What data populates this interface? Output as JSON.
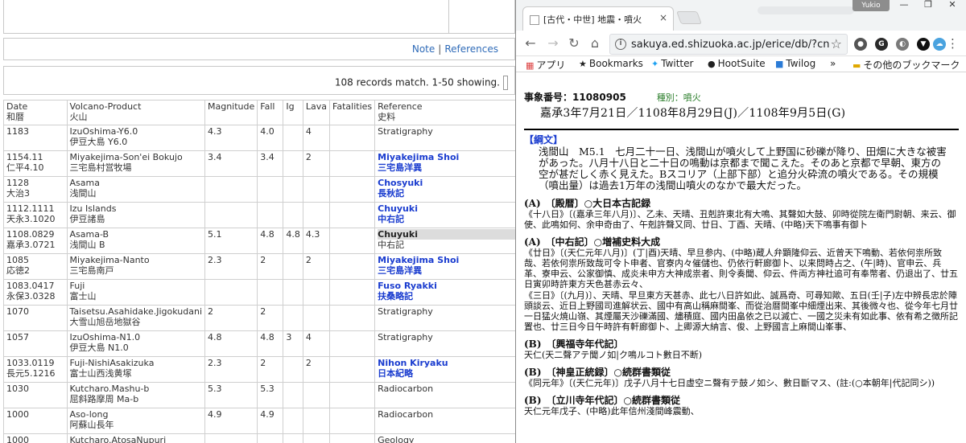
{
  "left": {
    "notes": {
      "note_label": "Note",
      "sep": "|",
      "references_label": "References"
    },
    "records_text": "108 records match. 1-50 showing.",
    "headers": {
      "date": "Date",
      "date_jp": "和暦",
      "product": "Volcano-Product",
      "product_jp": "火山",
      "magnitude": "Magnitude",
      "fall": "Fall",
      "ig": "Ig",
      "lava": "Lava",
      "fatalities": "Fatalities",
      "reference": "Reference",
      "reference_jp": "史料"
    },
    "rows": [
      {
        "date": "1183",
        "date_jp": "",
        "product": "IzuOshima-Y6.0",
        "product_jp": "伊豆大島 Y6.0",
        "mag": "4.3",
        "fall": "4.0",
        "ig": "",
        "lava": "4",
        "fat": "",
        "ref": "Stratigraphy",
        "ref_jp": "",
        "ref_style": "plain"
      },
      {
        "date": "1154.11",
        "date_jp": "仁平4.10",
        "product": "Miyakejima-Son'ei Bokujo",
        "product_jp": "三宅島村営牧場",
        "mag": "3.4",
        "fall": "3.4",
        "ig": "",
        "lava": "2",
        "fat": "",
        "ref": "Miyakejima Shoi",
        "ref_jp": "三宅島洋異",
        "ref_style": "link"
      },
      {
        "date": "1128",
        "date_jp": "大治3",
        "product": "Asama",
        "product_jp": "浅間山",
        "mag": "",
        "fall": "",
        "ig": "",
        "lava": "",
        "fat": "",
        "ref": "Chosyuki",
        "ref_jp": "長秋記",
        "ref_style": "link"
      },
      {
        "date": "1112.1111",
        "date_jp": "天永3.1020",
        "product": "Izu Islands",
        "product_jp": "伊豆諸島",
        "mag": "",
        "fall": "",
        "ig": "",
        "lava": "",
        "fat": "",
        "ref": "Chuyuki",
        "ref_jp": "中右記",
        "ref_style": "link"
      },
      {
        "date": "1108.0829",
        "date_jp": "嘉承3.0721",
        "product": "Asama-B",
        "product_jp": "浅間山 B",
        "mag": "5.1",
        "fall": "4.8",
        "ig": "4.8",
        "lava": "4.3",
        "fat": "",
        "ref": "Chuyuki",
        "ref_jp": "中右記",
        "ref_style": "highlight"
      },
      {
        "date": "1085",
        "date_jp": "応徳2",
        "product": "Miyakejima-Nanto",
        "product_jp": "三宅島南戸",
        "mag": "2.3",
        "fall": "2",
        "ig": "",
        "lava": "2",
        "fat": "",
        "ref": "Miyakejima Shoi",
        "ref_jp": "三宅島洋異",
        "ref_style": "link"
      },
      {
        "date": "1083.0417",
        "date_jp": "永保3.0328",
        "product": "Fuji",
        "product_jp": "富士山",
        "mag": "",
        "fall": "",
        "ig": "",
        "lava": "",
        "fat": "",
        "ref": "Fuso Ryakki",
        "ref_jp": "扶桑略記",
        "ref_style": "link"
      },
      {
        "date": "1070",
        "date_jp": "",
        "product": "Taisetsu.Asahidake.Jigokudani",
        "product_jp": "大雪山旭岳地獄谷",
        "mag": "2",
        "fall": "2",
        "ig": "",
        "lava": "",
        "fat": "",
        "ref": "Stratigraphy",
        "ref_jp": "",
        "ref_style": "plain"
      },
      {
        "date": "1057",
        "date_jp": "",
        "product": "IzuOshima-N1.0",
        "product_jp": "伊豆大島 N1.0",
        "mag": "4.8",
        "fall": "4.8",
        "ig": "3",
        "lava": "4",
        "fat": "",
        "ref": "Stratigraphy",
        "ref_jp": "",
        "ref_style": "plain"
      },
      {
        "date": "1033.0119",
        "date_jp": "長元5.1216",
        "product": "Fuji-NishiAsakizuka",
        "product_jp": "富士山西浅黄塚",
        "mag": "2.3",
        "fall": "2",
        "ig": "",
        "lava": "2",
        "fat": "",
        "ref": "Nihon Kiryaku",
        "ref_jp": "日本紀略",
        "ref_style": "link"
      },
      {
        "date": "1030",
        "date_jp": "",
        "product": "Kutcharo.Mashu-b",
        "product_jp": "屈斜路摩周 Ma-b",
        "mag": "5.3",
        "fall": "5.3",
        "ig": "",
        "lava": "",
        "fat": "",
        "ref": "Radiocarbon",
        "ref_jp": "",
        "ref_style": "plain"
      },
      {
        "date": "1000",
        "date_jp": "",
        "product": "Aso-long",
        "product_jp": "阿蘇山長年",
        "mag": "4.9",
        "fall": "4.9",
        "ig": "",
        "lava": "",
        "fat": "",
        "ref": "Radiocarbon",
        "ref_jp": "",
        "ref_style": "plain"
      },
      {
        "date": "1000",
        "date_jp": "",
        "product": "Kutcharo.AtosaNupuri",
        "product_jp": "",
        "mag": "",
        "fall": "",
        "ig": "",
        "lava": "",
        "fat": "",
        "ref": "Geology",
        "ref_jp": "",
        "ref_style": "plain"
      }
    ]
  },
  "browser": {
    "tab_title": "[古代・中世] 地震・噴火",
    "tab_close": "×",
    "user_chip": "Yukio",
    "url": "sakuya.ed.shizuoka.ac.jp/erice/db/?cn",
    "bookmarks": {
      "apps": "アプリ",
      "bookmarks": "Bookmarks",
      "twitter": "Twitter",
      "hootsuite": "HootSuite",
      "twilog": "Twilog",
      "more": "»",
      "other": "その他のブックマーク"
    }
  },
  "record": {
    "number": "事象番号：11080905",
    "type": "種別：噴火",
    "date": "嘉承3年7月21日／1108年8月29日(J)／1108年9月5日(G)",
    "kobun_label": "【綱文】",
    "kobun_text": "浅間山　M5.1　七月二十一日、浅間山が噴火して上野国に砂礫が降り、田畑に大きな被害があった。八月十八日と二十日の鳴動は京都まで聞こえた。そのあと京都で早朝、東方の空が甚だしく赤く見えた。Bスコリア（上部下部）と追分火砕流の噴火である。その規模（噴出量）は過去1万年の浅間山噴火のなかで最大だった。",
    "sources": [
      {
        "head": "(A)　〔殿暦〕○大日本古記録",
        "text": "《十八日》〔(嘉承三年八月)〕、乙未、天晴、丑剋許東北有大鳴、其聲如大鼓、卯時從院左衛門尉朝、来云、御使、此鳴如何、余申奇由了、午剋許聲又同、廿日、丁酉、天晴、(中略)天下鳴事有御卜"
      },
      {
        "head": "(A)　〔中右記〕○増補史料大成",
        "text": "《廿日》〔(天仁元年八月)〕(丁|酉)天晴、早旦参内、(中略)蔵人弁顕隆仰云、近曾天下鳴動、若依何祟所致哉、若依何祟所致哉可令卜申者、官寮内々催儲也、仍依行軒廊御卜、以来問時占之、(午|時)、官申云、兵革、寮申云、公家御慎、成炎未申方大神成祟者、則令奏聞、仰云、件両方神社追可有奉幣者、仍退出了、廿五日寅卯時許東方天色甚赤云々、"
      },
      {
        "head": "",
        "text": "《三日》〔(九月)〕、天晴、早旦東方天甚赤、此七八日許如此、誠爲奇、可尋知歟、五日(壬|子)左中辨長忠於陣頭談云、近日上野國司進解状云、國中有高山稱麻間峯、而從治暦間峯中細煙出来、其後微々也、從今年七月廿一日猛火焼山嶺、其煙屬天沙礫滿國、燼積庭、國内田畠依之已以滅亡、一國之災未有如此事、依有希之徴所記置也、廿三日今日午時許有軒廊御卜、上卿源大納言、俊、上野國言上麻間山峯事、"
      },
      {
        "head": "(B)　〔興福寺年代記〕",
        "text": "天仁(天二聲アテ聞ノ如|ク鳴ルコト數日不断)"
      },
      {
        "head": "(B)　〔神皇正統録〕○続群書類従",
        "text": "《同元年》〔(天仁元年)〕戊子八月十七日虚空ニ聲有テ鼓ノ如シ、數日斷マス、(註:(○本朝年|代記同シ))"
      },
      {
        "head": "(B)　〔立川寺年代記〕○続群書類従",
        "text": "天仁元年戊子、(中略)此年信州淺間峰震動、"
      }
    ]
  },
  "colors": {
    "link": "#1a3ccf",
    "highlight": "#dcdcdc",
    "green": "#168a16"
  },
  "icons": [
    "info-icon",
    "star-icon",
    "back-icon",
    "forward-icon",
    "reload-icon",
    "home-icon",
    "menu-icon",
    "folder-icon",
    "twitter-icon",
    "apps-icon"
  ]
}
